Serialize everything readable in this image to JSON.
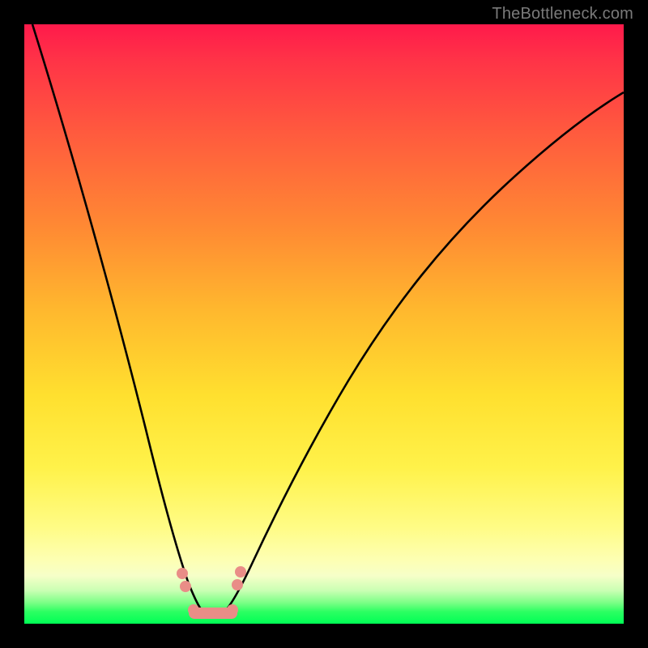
{
  "watermark": "TheBottleneck.com",
  "chart_data": {
    "type": "line",
    "title": "",
    "xlabel": "",
    "ylabel": "",
    "xlim": [
      0,
      100
    ],
    "ylim": [
      0,
      100
    ],
    "grid": false,
    "legend": false,
    "annotations": [],
    "series": [
      {
        "name": "bottleneck-curve",
        "x": [
          1,
          5,
          10,
          15,
          20,
          23,
          26,
          28,
          30,
          32,
          34,
          36,
          40,
          45,
          50,
          55,
          60,
          70,
          80,
          90,
          100
        ],
        "y": [
          100,
          84,
          62,
          42,
          22,
          10,
          3,
          0,
          0,
          0,
          1,
          4,
          12,
          22,
          32,
          40,
          47,
          58,
          66,
          72,
          76
        ]
      }
    ],
    "valley": {
      "x_start": 27,
      "x_end": 33,
      "y": 0
    },
    "background_gradient": {
      "top": "#ff1a4b",
      "mid": "#ffe02f",
      "bottom": "#00ff55"
    }
  }
}
